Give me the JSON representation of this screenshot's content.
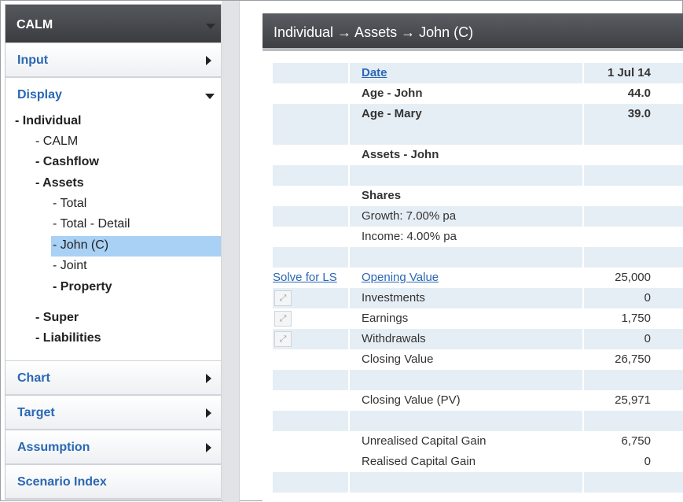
{
  "sidebar": {
    "title": "CALM",
    "sections": {
      "input": "Input",
      "display": "Display",
      "chart": "Chart",
      "target": "Target",
      "assumption": "Assumption",
      "scenario_index": "Scenario Index"
    },
    "tree": {
      "individual": "- Individual",
      "calm": "- CALM",
      "cashflow": "- Cashflow",
      "assets": "- Assets",
      "total": "- Total",
      "total_detail": "- Total - Detail",
      "john": "- John (C)",
      "joint": "- Joint",
      "property": "- Property",
      "super": "- Super",
      "liabilities": "- Liabilities"
    }
  },
  "main": {
    "title": "Individual → Assets → John (C)",
    "rows": {
      "date": {
        "label": "Date",
        "value": "1 Jul 14"
      },
      "age_john": {
        "label": "Age - John",
        "value": "44.0"
      },
      "age_mary": {
        "label": "Age - Mary",
        "value": "39.0"
      },
      "assets_john": {
        "label": "Assets - John"
      },
      "shares": {
        "label": "Shares"
      },
      "growth": {
        "label": "Growth: 7.00% pa"
      },
      "income": {
        "label": "Income: 4.00% pa"
      },
      "opening": {
        "action": "Solve for LS",
        "label": "Opening Value",
        "value": "25,000"
      },
      "investments": {
        "label": "Investments",
        "value": "0"
      },
      "earnings": {
        "label": "Earnings",
        "value": "1,750"
      },
      "withdrawals": {
        "label": "Withdrawals",
        "value": "0"
      },
      "closing": {
        "label": "Closing Value",
        "value": "26,750"
      },
      "closing_pv": {
        "label": "Closing Value (PV)",
        "value": "25,971"
      },
      "unrealised": {
        "label": "Unrealised Capital Gain",
        "value": "6,750"
      },
      "realised": {
        "label": "Realised Capital Gain",
        "value": "0"
      }
    },
    "expand_icon": "expand-arrows-icon"
  },
  "colors": {
    "header_dark": "#3c3e42",
    "link_blue": "#2a67b4",
    "row_alt": "#e6eef5",
    "selected": "#a9d1f5"
  }
}
